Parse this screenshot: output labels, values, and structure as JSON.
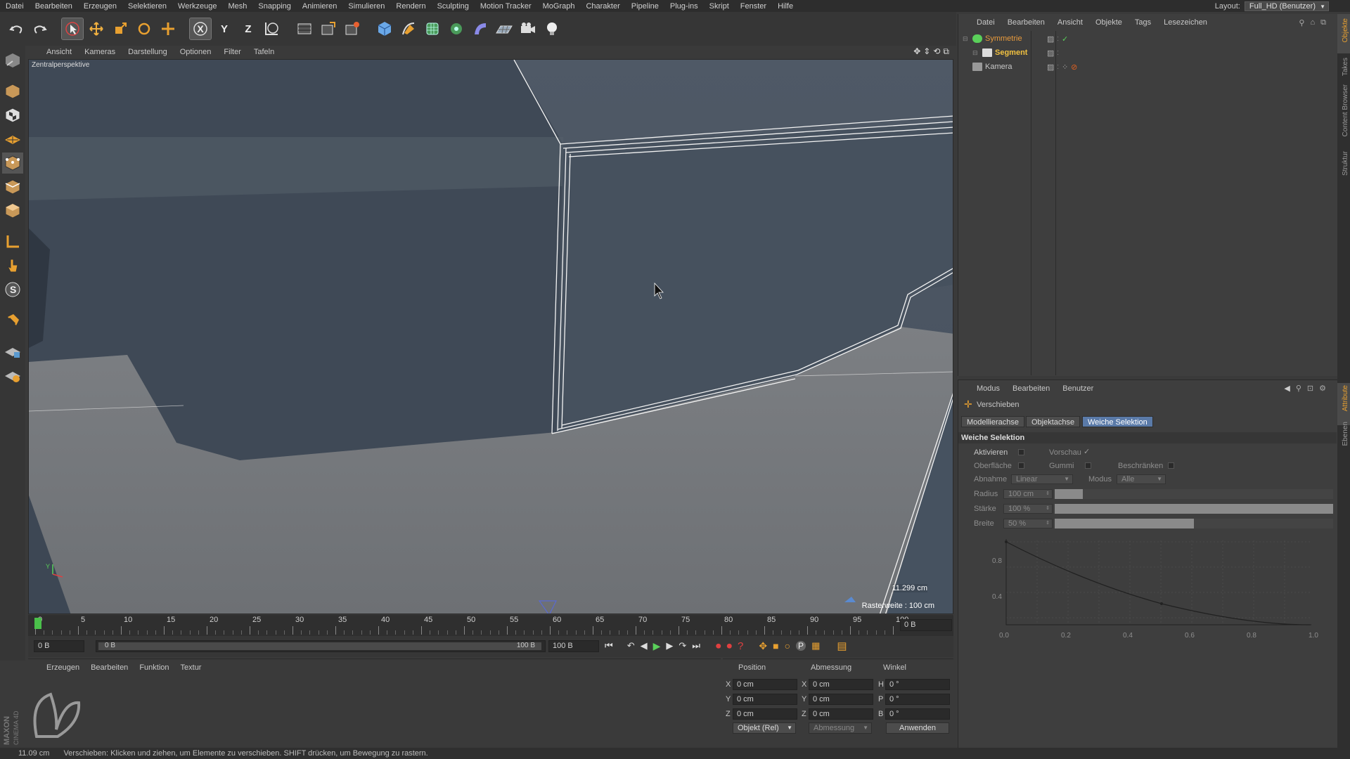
{
  "menubar": {
    "items": [
      "Datei",
      "Bearbeiten",
      "Erzeugen",
      "Selektieren",
      "Werkzeuge",
      "Mesh",
      "Snapping",
      "Animieren",
      "Simulieren",
      "Rendern",
      "Sculpting",
      "Motion Tracker",
      "MoGraph",
      "Charakter",
      "Pipeline",
      "Plug-ins",
      "Skript",
      "Fenster",
      "Hilfe"
    ],
    "layout_label": "Layout:",
    "layout_value": "Full_HD (Benutzer)"
  },
  "toolbar": {
    "axis_x": "X",
    "axis_y": "Y",
    "axis_z": "Z"
  },
  "viewport": {
    "menu": [
      "Ansicht",
      "Kameras",
      "Darstellung",
      "Optionen",
      "Filter",
      "Tafeln"
    ],
    "camera_label": "Zentralperspektive",
    "distance": "11.299 cm",
    "grid_spacing": "Rasterweite : 100 cm",
    "axis_y": "Y",
    "axis_x": "X"
  },
  "timeline": {
    "ticks": [
      "0",
      "5",
      "10",
      "15",
      "20",
      "25",
      "30",
      "35",
      "40",
      "45",
      "50",
      "55",
      "60",
      "65",
      "70",
      "75",
      "80",
      "85",
      "90",
      "95",
      "100"
    ],
    "current_frame_field": "0 B",
    "start_field": "0 B",
    "range_start": "0 B",
    "range_end": "100 B",
    "end_field": "100 B"
  },
  "material_manager": {
    "menu": [
      "Erzeugen",
      "Bearbeiten",
      "Funktion",
      "Textur"
    ]
  },
  "coordinates": {
    "headers": [
      "Position",
      "Abmessung",
      "Winkel"
    ],
    "rows": [
      {
        "axis": "X",
        "pos": "0 cm",
        "size_axis": "X",
        "size": "0 cm",
        "rot_axis": "H",
        "rot": "0 °"
      },
      {
        "axis": "Y",
        "pos": "0 cm",
        "size_axis": "Y",
        "size": "0 cm",
        "rot_axis": "P",
        "rot": "0 °"
      },
      {
        "axis": "Z",
        "pos": "0 cm",
        "size_axis": "Z",
        "size": "0 cm",
        "rot_axis": "B",
        "rot": "0 °"
      }
    ],
    "mode": "Objekt (Rel)",
    "size_mode": "Abmessung",
    "apply": "Anwenden"
  },
  "object_manager": {
    "menu": [
      "Datei",
      "Bearbeiten",
      "Ansicht",
      "Objekte",
      "Tags",
      "Lesezeichen"
    ],
    "objects": [
      {
        "name": "Symmetrie",
        "color": "#e89a3c"
      },
      {
        "name": "Segment",
        "color": "#f0c040"
      },
      {
        "name": "Kamera",
        "color": "#c8c8c8"
      }
    ]
  },
  "attribute_manager": {
    "menu": [
      "Modus",
      "Bearbeiten",
      "Benutzer"
    ],
    "tool_name": "Verschieben",
    "tabs": [
      "Modellierachse",
      "Objektachse",
      "Weiche Selektion"
    ],
    "section": "Weiche Selektion",
    "aktivieren": "Aktivieren",
    "vorschau": "Vorschau",
    "oberflaeche": "Oberfläche",
    "gummi": "Gummi",
    "beschraenken": "Beschränken",
    "abnahme": "Abnahme",
    "abnahme_value": "Linear",
    "modus": "Modus",
    "modus_value": "Alle",
    "radius": "Radius",
    "radius_value": "100 cm",
    "staerke": "Stärke",
    "staerke_value": "100 %",
    "breite": "Breite",
    "breite_value": "50 %",
    "graph_y": [
      "0.8",
      "0.4"
    ],
    "graph_x": [
      "0.0",
      "0.2",
      "0.4",
      "0.6",
      "0.8",
      "1.0"
    ],
    "radius_fill": 0.1,
    "staerke_fill": 1.0,
    "breite_fill": 0.5
  },
  "right_tabs": [
    "Objekte",
    "Takes",
    "Content Browser",
    "Struktur",
    "Attribute",
    "Ebenen"
  ],
  "status": {
    "value": "11.09 cm",
    "message": "Verschieben: Klicken und ziehen, um Elemente zu verschieben. SHIFT drücken, um Bewegung zu rastern."
  },
  "brand": {
    "line1": "MAXON",
    "line2": "CINEMA 4D"
  }
}
